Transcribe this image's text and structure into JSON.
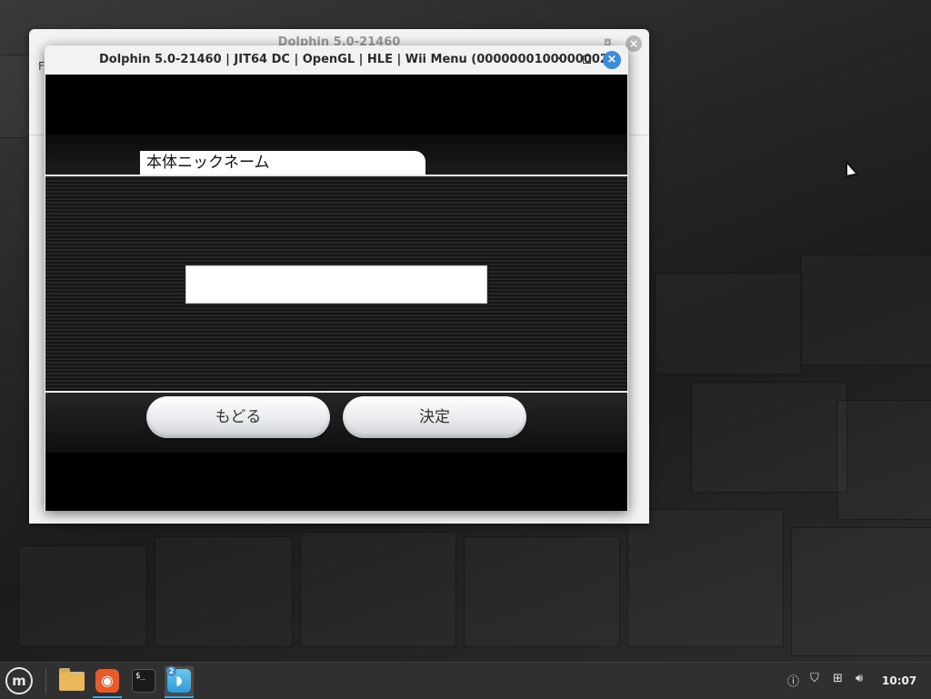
{
  "desktop": {
    "background_window": {
      "title": "Dolphin 5.0-21460",
      "menu_letter": "F"
    },
    "front_window": {
      "title": "Dolphin 5.0-21460 | JIT64 DC | OpenGL | HLE | Wii Menu (0000000100000002)",
      "game": {
        "tab_label": "本体ニックネーム",
        "nickname_value": "",
        "back_button": "もどる",
        "confirm_button": "決定"
      }
    }
  },
  "taskbar": {
    "workspace_badge": "2",
    "clock": "10:07"
  },
  "colors": {
    "window_close_accent": "#3a8ed9",
    "taskbar": "#303030",
    "game_background": "#000000"
  }
}
